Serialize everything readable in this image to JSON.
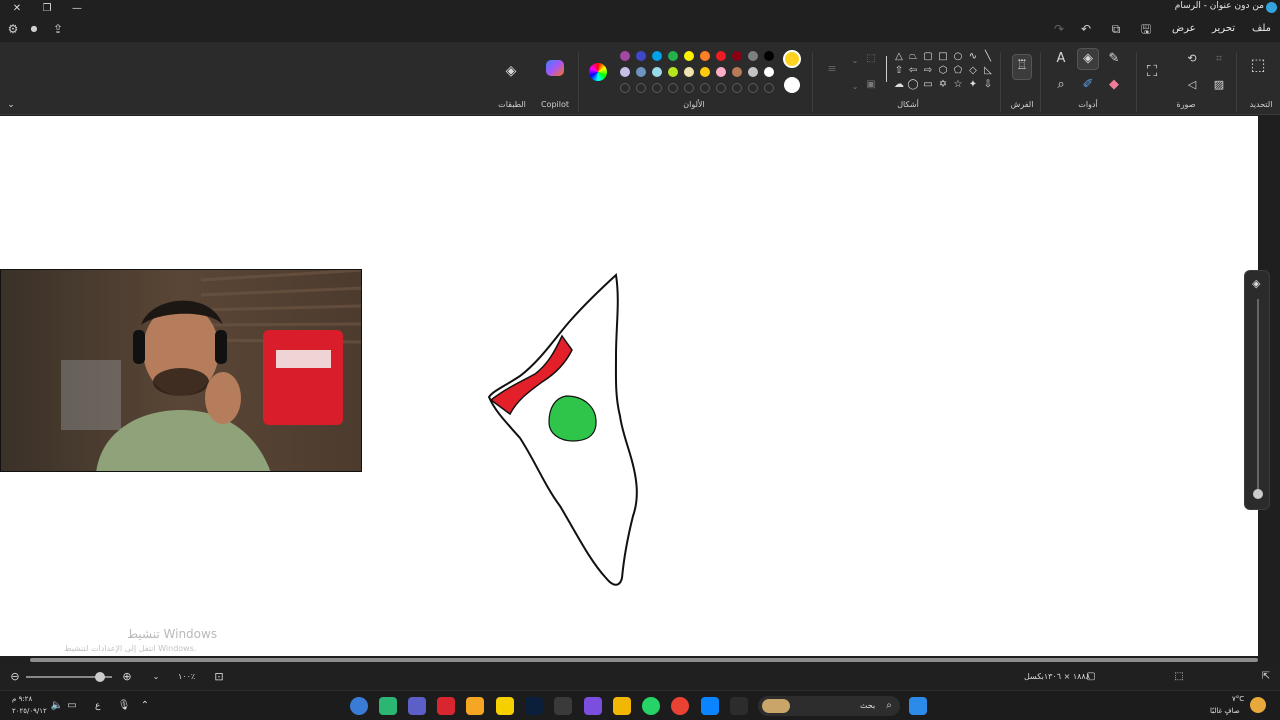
{
  "window": {
    "title": "من دون عنوان - الرسام"
  },
  "menu": {
    "file": "ملف",
    "edit": "تحرير",
    "view": "عرض"
  },
  "ribbon": {
    "groups": {
      "selection": "التحديد",
      "image": "صورة",
      "tools": "أدوات",
      "brushes": "الفرش",
      "shapes": "أشكال",
      "colors": "الألوان",
      "copilot": "Copilot",
      "layers": "الطبقات"
    },
    "palette_row1": [
      "#000000",
      "#7f7f7f",
      "#880015",
      "#ed1c24",
      "#ff7f27",
      "#fff200",
      "#22b14c",
      "#00a2e8",
      "#3f48cc",
      "#a349a4"
    ],
    "palette_row2": [
      "#ffffff",
      "#c3c3c3",
      "#b97a57",
      "#ffaec9",
      "#ffc90e",
      "#efe4b0",
      "#b5e61d",
      "#99d9ea",
      "#7092be",
      "#c8bfe7"
    ],
    "primary_color": "#ffd21f",
    "secondary_color": "#ffffff"
  },
  "status": {
    "canvas_size": "١٨٨٨ × ١٣٠٦بكسل",
    "zoom": "١٠٠٪"
  },
  "watermark": {
    "line1": "تنشيط Windows",
    "line2": "انتقل إلى الإعدادات لتنشيط Windows."
  },
  "taskbar": {
    "search_placeholder": "بحث",
    "weather_temp": "٧°C",
    "weather_desc": "صافٍ غالبًا",
    "time": "٩:٢٨ م",
    "date": "٢٠٢٥/٠٩/١٢",
    "lang": "ع"
  }
}
